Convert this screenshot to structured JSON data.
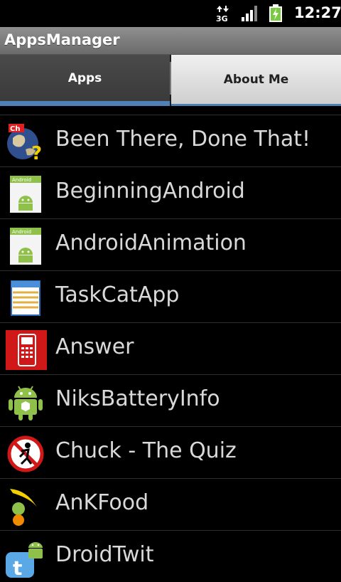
{
  "status_bar": {
    "network": "3G",
    "time": "12:27",
    "icons": [
      "network-3g-icon",
      "signal-icon",
      "battery-charging-icon"
    ]
  },
  "app": {
    "title": "AppsManager"
  },
  "tabs": [
    {
      "label": "Apps",
      "selected": true
    },
    {
      "label": "About Me",
      "selected": false
    }
  ],
  "apps": [
    {
      "name": "Been There, Done That!",
      "icon": "globe-question-icon"
    },
    {
      "name": "BeginningAndroid",
      "icon": "android-default-icon"
    },
    {
      "name": "AndroidAnimation",
      "icon": "android-default-icon"
    },
    {
      "name": "TaskCatApp",
      "icon": "task-list-icon"
    },
    {
      "name": "Answer",
      "icon": "phone-icon"
    },
    {
      "name": "NiksBatteryInfo",
      "icon": "android-robot-icon"
    },
    {
      "name": "Chuck - The Quiz",
      "icon": "no-running-icon"
    },
    {
      "name": "AnKFood",
      "icon": "fruit-icon"
    },
    {
      "name": "DroidTwit",
      "icon": "twitter-bird-icon"
    }
  ],
  "colors": {
    "tab_indicator": "#5080b8",
    "list_text": "#d9d9d9",
    "background": "#000000"
  }
}
